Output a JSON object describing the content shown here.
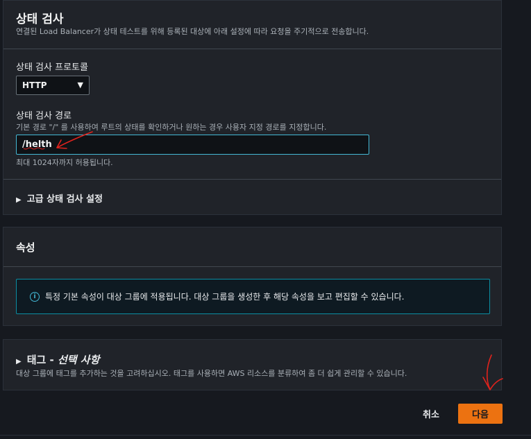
{
  "health_check": {
    "title": "상태 검사",
    "description": "연결된 Load Balancer가 상태 테스트를 위해 등록된 대상에 아래 설정에 따라 요청을 주기적으로 전송합니다.",
    "protocol_label": "상태 검사 프로토콜",
    "protocol_value": "HTTP",
    "path_label": "상태 검사 경로",
    "path_help": "기본 경로 \"/\" 를 사용하여 루트의 상태를 확인하거나 원하는 경우 사용자 지정 경로를 지정합니다.",
    "path_value": "/helth",
    "path_constraint": "최대 1024자까지 허용됩니다.",
    "advanced_label": "고급 상태 검사 설정"
  },
  "attributes": {
    "title": "속성",
    "info_text": "특정 기본 속성이 대상 그룹에 적용됩니다. 대상 그룹을 생성한 후 해당 속성을 보고 편집할 수 있습니다."
  },
  "tags": {
    "title_prefix": "태그 - ",
    "title_optional": "선택 사항",
    "description": "대상 그룹에 태그를 추가하는 것을 고려하십시오. 태그를 사용하면 AWS 리소스를 분류하여 좀 더 쉽게 관리할 수 있습니다."
  },
  "footer": {
    "cancel_label": "취소",
    "next_label": "다음"
  },
  "colors": {
    "primary_button": "#ec7211",
    "info_border": "#0c8ea3",
    "annotation": "#e0231d"
  }
}
